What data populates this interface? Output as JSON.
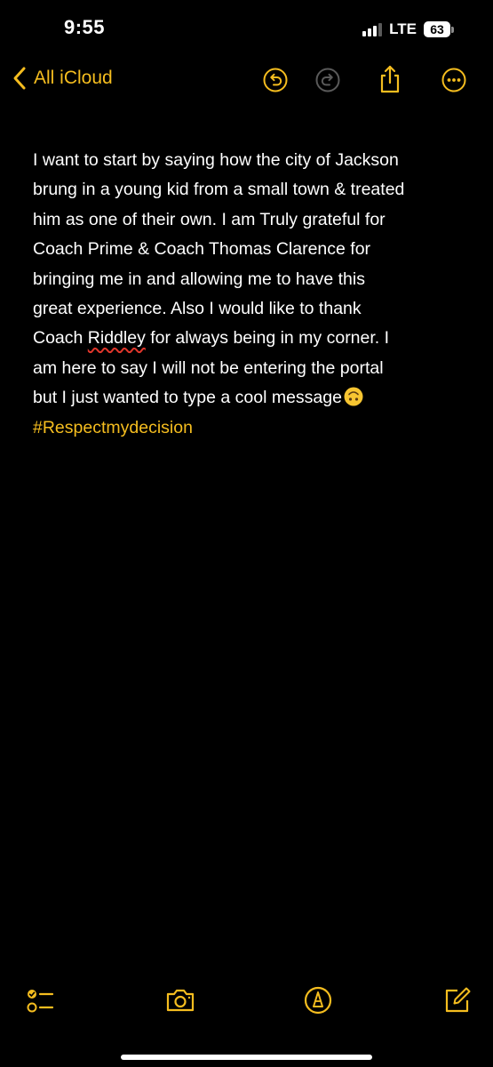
{
  "status_bar": {
    "time": "9:55",
    "network": "LTE",
    "battery_percent": "63"
  },
  "nav": {
    "back_label": "All iCloud",
    "icons": [
      "undo-icon",
      "redo-icon",
      "share-icon",
      "more-icon"
    ]
  },
  "note": {
    "lines": [
      "I want to start by saying how the city of Jackson",
      "brung in a young kid from a small town & treated",
      "him as one of their own. I am Truly grateful for",
      "Coach Prime & Coach Thomas Clarence for",
      "bringing me in and allowing me to have this",
      "great experience. Also I would like to thank"
    ],
    "line7_prefix": "Coach ",
    "line7_misspelled": "Riddley",
    "line7_suffix": " for always being in my corner. I",
    "line8": "am here to say I will not be entering the portal",
    "line9": "but I just wanted to type a cool message",
    "emoji": "upside-down-face",
    "hashtag": "#Respectmydecision"
  },
  "toolbar": {
    "icons": [
      "checklist-icon",
      "camera-icon",
      "markup-pen-icon",
      "compose-icon"
    ]
  },
  "colors": {
    "accent": "#f5bd1f",
    "background": "#000000",
    "text": "#ffffff",
    "spellcheck": "#e0362b",
    "disabled_icon": "#5a5a5a"
  }
}
